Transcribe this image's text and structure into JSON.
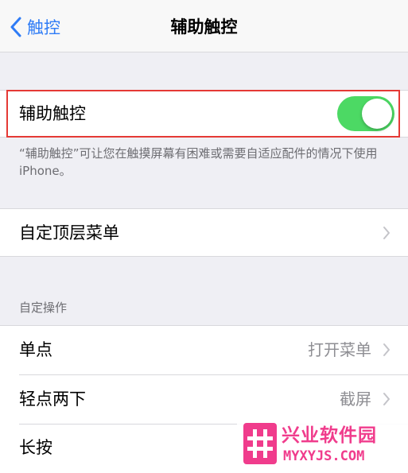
{
  "navbar": {
    "back_label": "触控",
    "title": "辅助触控"
  },
  "assistive_touch": {
    "label": "辅助触控",
    "enabled": true,
    "footnote": "“辅助触控”可让您在触摸屏幕有困难或需要自适应配件的情况下使用iPhone。"
  },
  "top_level_menu": {
    "label": "自定顶层菜单"
  },
  "custom_actions": {
    "header": "自定操作",
    "items": [
      {
        "label": "单点",
        "value": "打开菜单"
      },
      {
        "label": "轻点两下",
        "value": "截屏"
      },
      {
        "label": "长按",
        "value": ""
      }
    ]
  },
  "colors": {
    "accent": "#2f7cf6",
    "toggle_on": "#4cd964",
    "highlight": "#e53935",
    "watermark": "#f03c8c"
  },
  "watermark": {
    "name": "兴业软件园",
    "url": "MYXYJS.COM"
  }
}
